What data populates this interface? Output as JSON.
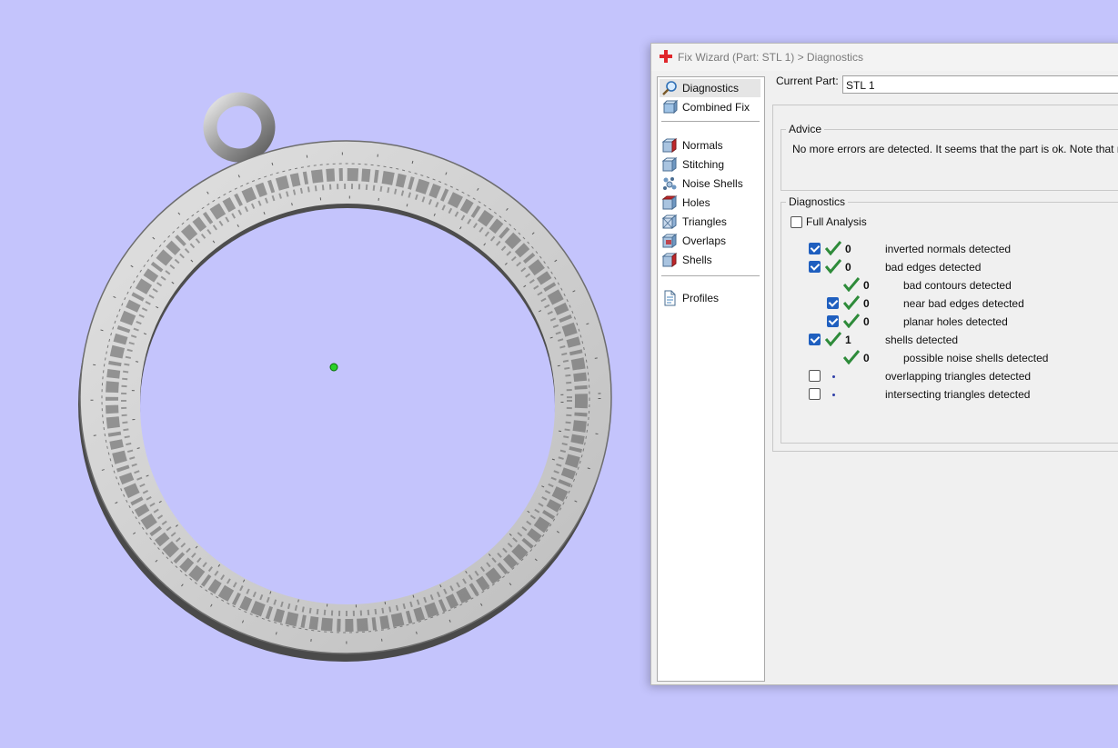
{
  "window": {
    "title": "Fix Wizard (Part: STL 1) > Diagnostics"
  },
  "nav": {
    "items": [
      {
        "label": "Diagnostics",
        "icon": "magnifier-icon"
      },
      {
        "label": "Combined Fix",
        "icon": "combined-fix-icon"
      },
      {
        "label": "Normals",
        "icon": "normals-cube-icon"
      },
      {
        "label": "Stitching",
        "icon": "stitching-cube-icon"
      },
      {
        "label": "Noise Shells",
        "icon": "noise-shells-icon"
      },
      {
        "label": "Holes",
        "icon": "holes-cube-icon"
      },
      {
        "label": "Triangles",
        "icon": "triangles-cube-icon"
      },
      {
        "label": "Overlaps",
        "icon": "overlaps-cube-icon"
      },
      {
        "label": "Shells",
        "icon": "shells-cube-icon"
      },
      {
        "label": "Profiles",
        "icon": "document-icon"
      }
    ],
    "selected": "Diagnostics"
  },
  "current_part": {
    "label": "Current Part:",
    "value": "STL 1"
  },
  "advice": {
    "title": "Advice",
    "text": "No more errors are detected. It seems that the part is ok. Note that not all"
  },
  "diagnostics": {
    "title": "Diagnostics",
    "full_analysis_label": "Full Analysis",
    "rows": [
      {
        "checked": true,
        "status": "ok",
        "count": "0",
        "label": "inverted normals detected"
      },
      {
        "checked": true,
        "status": "ok",
        "count": "0",
        "label": "bad edges detected"
      },
      {
        "checked": null,
        "status": "ok",
        "count": "0",
        "label": "bad contours detected"
      },
      {
        "checked": true,
        "status": "ok",
        "count": "0",
        "label": "near bad edges detected"
      },
      {
        "checked": true,
        "status": "ok",
        "count": "0",
        "label": "planar holes detected"
      },
      {
        "checked": true,
        "status": "ok",
        "count": "1",
        "label": "shells detected"
      },
      {
        "checked": null,
        "status": "ok",
        "count": "0",
        "label": "possible noise shells detected"
      },
      {
        "checked": false,
        "status": "pending",
        "count": "",
        "label": "overlapping triangles detected"
      },
      {
        "checked": false,
        "status": "pending",
        "count": "",
        "label": "intersecting triangles detected"
      }
    ]
  },
  "colors": {
    "viewport_background": "#c4c4fc",
    "checkbox_checked": "#1f5fbf",
    "ok_tick": "#2e8b3a",
    "app_icon": "#e0262b"
  }
}
